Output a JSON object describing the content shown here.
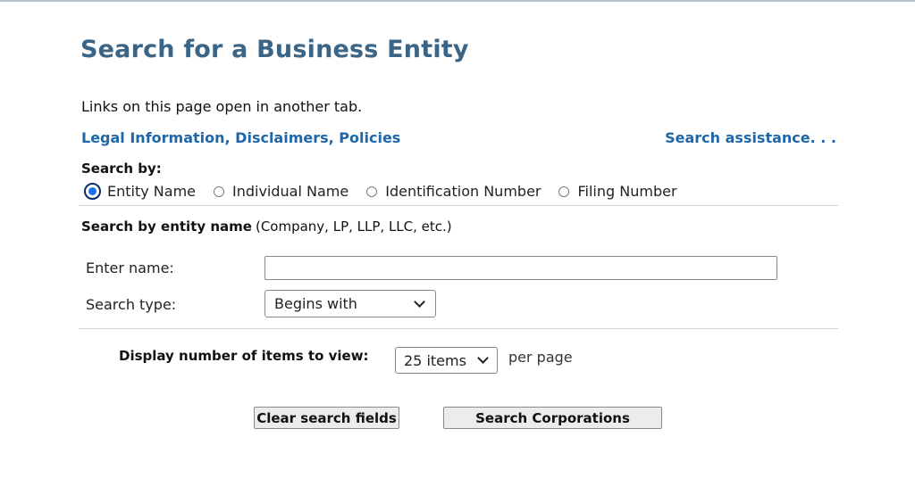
{
  "page": {
    "title": "Search for a Business Entity",
    "notice": "Links on this page open in another tab."
  },
  "links": {
    "legal": "Legal Information, Disclaimers, Policies",
    "assistance": "Search assistance. . ."
  },
  "search_by": {
    "label": "Search by:",
    "options": [
      {
        "label": "Entity Name",
        "selected": true
      },
      {
        "label": "Individual Name",
        "selected": false
      },
      {
        "label": "Identification Number",
        "selected": false
      },
      {
        "label": "Filing Number",
        "selected": false
      }
    ]
  },
  "section": {
    "heading_bold": "Search by entity name",
    "heading_note": "(Company, LP, LLP, LLC, etc.)"
  },
  "form": {
    "name_label": "Enter name:",
    "name_value": "",
    "type_label": "Search type:",
    "type_selected": "Begins with"
  },
  "display": {
    "label": "Display number of items to view:",
    "selected": "25 items",
    "suffix": "per page"
  },
  "buttons": {
    "clear": "Clear search fields",
    "search": "Search Corporations"
  },
  "colors": {
    "title": "#3a6586",
    "link": "#1f67a8",
    "radio_selected": "#1a73e8"
  }
}
